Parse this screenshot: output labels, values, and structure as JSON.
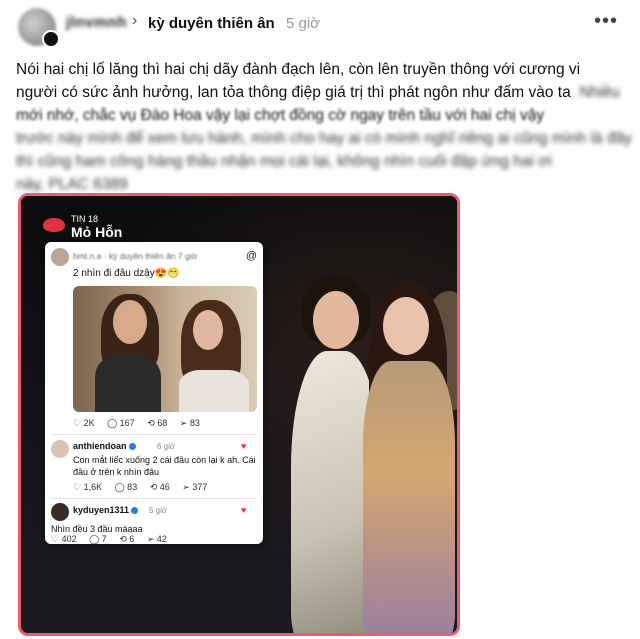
{
  "header": {
    "username": "jlnvmnh",
    "separator": "›",
    "topic": "kỳ duyên thiên ân",
    "time": "5 giờ",
    "more": "•••"
  },
  "post": {
    "line1": "Nói hai chị lố lăng thì hai chị dãy đành đạch lên, còn lên truyền thông với cương vi",
    "line2_clear": "người có sức ảnh hưởng, lan tỏa thông điệp giá trị thì phát ngôn như đấm vào ta",
    "line2_blur": ". Nhiều",
    "line3": "mới nhớ, chắc vụ Đào Hoa vậy lại chợt đồng cờ ngay trên tầu với hai chị vậy",
    "line4": "trước này mình để xem lưu hành, mình cho hay ai có mình nghĩ riêng ai cũng mình là đây",
    "line5": "thì cũng ham công hàng thầu nhận mọi cái lại, không nhìn cuối đập ứng hai ơi",
    "line6": "này, PLAC 6389"
  },
  "media": {
    "logo_line1": "TIN 18",
    "logo_line2": "Mỏ Hỗn",
    "card": {
      "meta": "hmt.n.a · kỳ duyên thiên ân 7 giờ",
      "threads_icon": "@",
      "caption": "2 nhìn đi đâu dzậy😍😁",
      "stats1": [
        "♡ 2K",
        "◯ 167",
        "⟲ 68",
        "➢ 83"
      ],
      "comment1": {
        "name": "anthiendoan",
        "time": "6 giờ",
        "text_line1": "Con mắt liếc xuống 2 cái đầu còn lại k ah. Cái",
        "text_line2": "đầu ở trên k nhìn đâu",
        "stats": [
          "♡ 1,6K",
          "◯ 83",
          "⟲ 46",
          "➢ 377"
        ]
      },
      "comment2": {
        "name": "kyduyen1311",
        "time": "5 giờ",
        "text": "Nhìn đều 3 đầu màaaa",
        "stats": [
          "♡ 402",
          "◯ 7",
          "⟲ 6",
          "➢ 42"
        ]
      }
    }
  },
  "colors": {
    "frame_border": "#ec5b6e",
    "verified": "#2a7de1",
    "heart": "#e0323f"
  }
}
